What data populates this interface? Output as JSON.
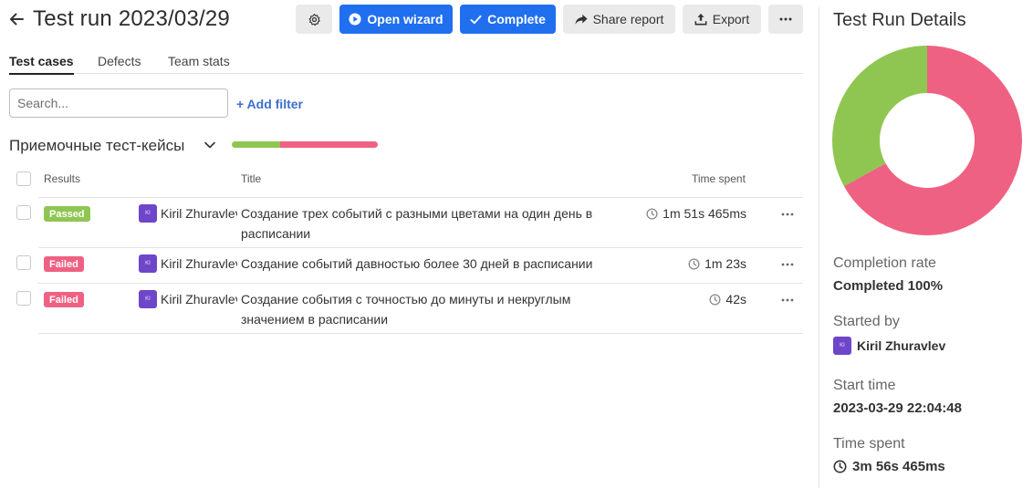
{
  "header": {
    "title": "Test run 2023/03/29",
    "open_wizard_label": "Open wizard",
    "complete_label": "Complete",
    "share_report_label": "Share report",
    "export_label": "Export"
  },
  "tabs": [
    {
      "label": "Test cases",
      "active": true
    },
    {
      "label": "Defects",
      "active": false
    },
    {
      "label": "Team stats",
      "active": false
    }
  ],
  "search": {
    "placeholder": "Search...",
    "value": ""
  },
  "add_filter_label": "+ Add filter",
  "group": {
    "title": "Приемочные тест-кейсы",
    "passed_fraction": 0.33,
    "failed_fraction": 0.67
  },
  "table": {
    "headers": {
      "results": "Results",
      "title": "Title",
      "time_spent": "Time spent"
    },
    "rows": [
      {
        "status": "Passed",
        "assignee": "Kiril Zhuravlev",
        "avatar_text": "KI",
        "title": "Создание трех событий с разными цветами на один день в расписании",
        "time": "1m 51s 465ms"
      },
      {
        "status": "Failed",
        "assignee": "Kiril Zhuravlev",
        "avatar_text": "KI",
        "title": "Создание событий давностью более 30 дней в расписании",
        "time": "1m 23s"
      },
      {
        "status": "Failed",
        "assignee": "Kiril Zhuravlev",
        "avatar_text": "KI",
        "title": "Создание события с точностью до минуты и некруглым значением в расписании",
        "time": "42s"
      }
    ]
  },
  "details": {
    "title": "Test Run Details",
    "chart": {
      "passed_fraction": 0.33,
      "failed_fraction": 0.67,
      "passed_color": "#8fc652",
      "failed_color": "#ef6182"
    },
    "completion_label": "Completion rate",
    "completion_value": "Completed 100%",
    "started_by_label": "Started by",
    "started_by_value": "Kiril Zhuravlev",
    "started_by_avatar": "KI",
    "start_time_label": "Start time",
    "start_time_value": "2023-03-29 22:04:48",
    "time_spent_label": "Time spent",
    "time_spent_value": "3m 56s 465ms"
  },
  "colors": {
    "accent": "#1f6fef",
    "passed": "#8fc652",
    "failed": "#ef6182",
    "avatar": "#6d46c9"
  }
}
